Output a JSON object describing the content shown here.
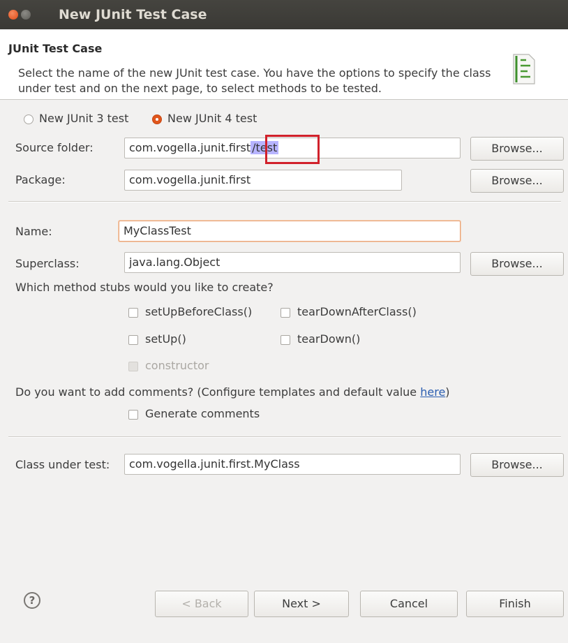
{
  "window": {
    "title": "New JUnit Test Case"
  },
  "header": {
    "title": "JUnit Test Case",
    "description": "Select the name of the new JUnit test case. You have the options to specify the class under test and on the next page, to select methods to be tested."
  },
  "version": {
    "junit3_label": "New JUnit 3 test",
    "junit4_label": "New JUnit 4 test",
    "selected": "New JUnit 4 test"
  },
  "form": {
    "source_folder": {
      "label": "Source folder:",
      "value_prefix": "com.vogella.junit.first",
      "value_selected": "/test"
    },
    "package": {
      "label": "Package:",
      "value": "com.vogella.junit.first"
    },
    "name": {
      "label": "Name:",
      "value": "MyClassTest"
    },
    "superclass": {
      "label": "Superclass:",
      "value": "java.lang.Object"
    },
    "class_under_test": {
      "label": "Class under test:",
      "value": "com.vogella.junit.first.MyClass"
    },
    "browse_label": "Browse..."
  },
  "stubs": {
    "question": "Which method stubs would you like to create?",
    "setup_before_class": "setUpBeforeClass()",
    "teardown_after_class": "tearDownAfterClass()",
    "setup": "setUp()",
    "teardown": "tearDown()",
    "constructor": "constructor"
  },
  "comments": {
    "question_prefix": "Do you want to add comments? (Configure templates and default value ",
    "link": "here",
    "question_suffix": ")",
    "generate": "Generate comments"
  },
  "footer": {
    "help": "?",
    "back": "< Back",
    "next": "Next >",
    "cancel": "Cancel",
    "finish": "Finish"
  }
}
